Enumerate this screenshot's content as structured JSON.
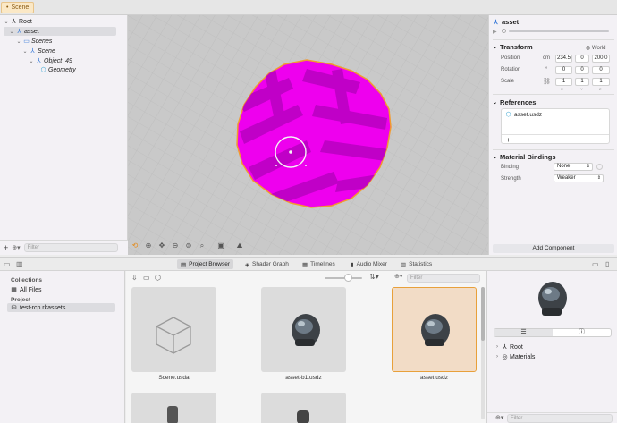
{
  "tabbar": {
    "scene_tab": "Scene"
  },
  "hierarchy": {
    "items": [
      {
        "label": "Root"
      },
      {
        "label": "asset"
      },
      {
        "label": "Scenes"
      },
      {
        "label": "Scene"
      },
      {
        "label": "Object_49"
      },
      {
        "label": "Geometry"
      }
    ],
    "filter_placeholder": "Filter",
    "add_label": "+"
  },
  "viewport": {
    "colors": {
      "mesh": "#ee00ee",
      "mesh_dark": "#b800c0",
      "outline": "#f29a2e",
      "grid_bg": "#c9c9c9"
    }
  },
  "inspector": {
    "title": "asset",
    "transform": {
      "title": "Transform",
      "space": "World",
      "position_label": "Position",
      "position_unit": "cm",
      "position": [
        "234.5",
        "0",
        "200.0"
      ],
      "rotation_label": "Rotation",
      "rotation_unit": "°",
      "rotation": [
        "0",
        "0",
        "0"
      ],
      "scale_label": "Scale",
      "scale": [
        "1",
        "1",
        "1"
      ],
      "axis_labels": [
        "X",
        "Y",
        "Z"
      ]
    },
    "references": {
      "title": "References",
      "item": "asset.usdz",
      "add": "+",
      "remove": "−"
    },
    "material_bindings": {
      "title": "Material Bindings",
      "binding_label": "Binding",
      "binding_value": "None",
      "strength_label": "Strength",
      "strength_value": "Weaker"
    },
    "add_component": "Add Component"
  },
  "bottom_toolbar": {
    "tabs": [
      "Project Browser",
      "Shader Graph",
      "Timelines",
      "Audio Mixer",
      "Statistics"
    ],
    "active_tab": "Project Browser"
  },
  "collections": {
    "collections_header": "Collections",
    "all_files": "All Files",
    "project_header": "Project",
    "project_item": "test-rcp.rkassets"
  },
  "browser": {
    "filter_placeholder": "Filter",
    "files": [
      {
        "name": "Scene.usda"
      },
      {
        "name": "asset-b1.usdz"
      },
      {
        "name": "asset.usdz"
      }
    ],
    "selected_file": "asset.usdz"
  },
  "preview": {
    "tree": [
      {
        "label": "Root"
      },
      {
        "label": "Materials"
      }
    ],
    "filter_placeholder": "Filter"
  }
}
